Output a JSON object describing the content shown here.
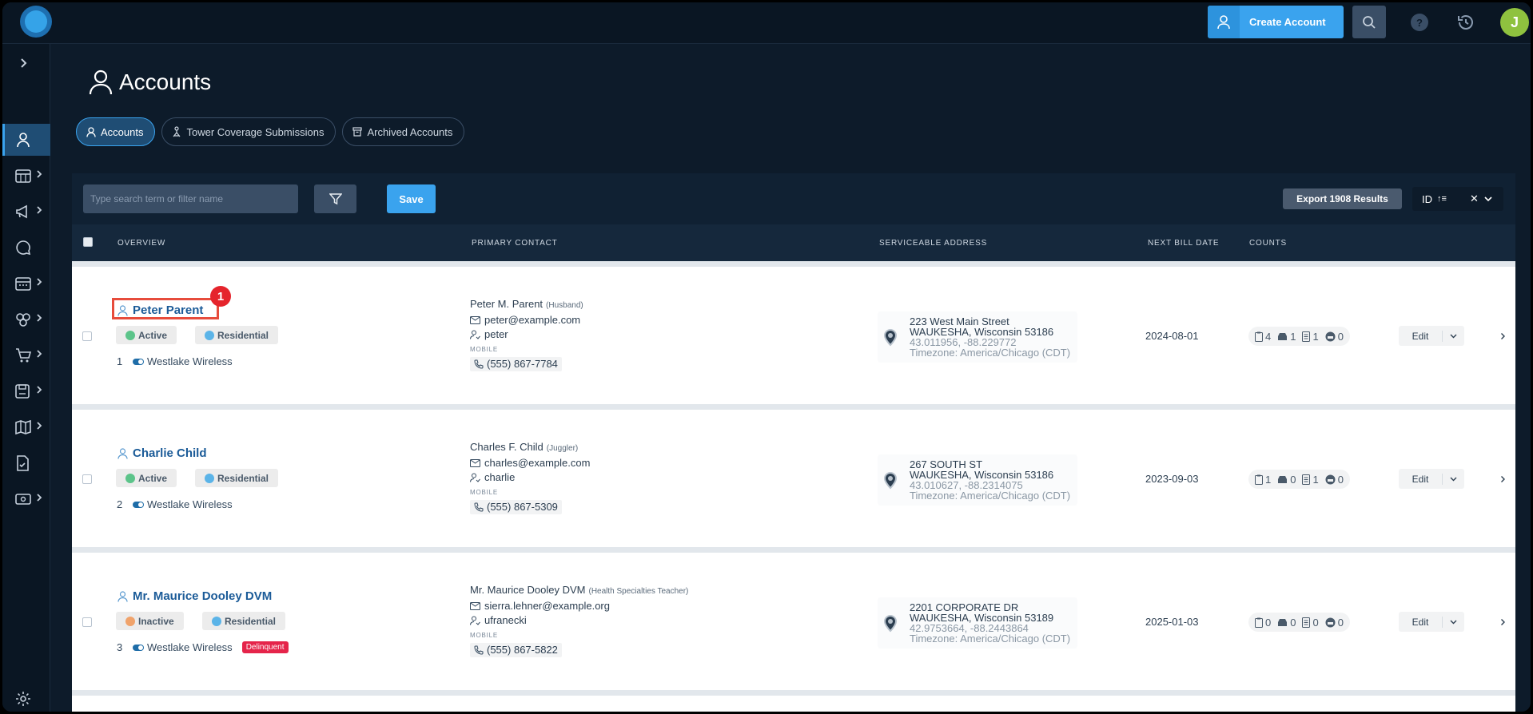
{
  "topbar": {
    "create_label": "Create Account",
    "help_label": "?",
    "avatar_initial": "J"
  },
  "page": {
    "title": "Accounts"
  },
  "tabs": [
    {
      "label": "Accounts",
      "icon": "user-icon",
      "active": true
    },
    {
      "label": "Tower Coverage Submissions",
      "icon": "tower-icon",
      "active": false
    },
    {
      "label": "Archived Accounts",
      "icon": "archive-icon",
      "active": false
    }
  ],
  "toolbar": {
    "search_placeholder": "Type search term or filter name",
    "save_label": "Save",
    "export_label": "Export 1908 Results",
    "sort_field": "ID"
  },
  "table": {
    "headers": [
      "OVERVIEW",
      "PRIMARY CONTACT",
      "SERVICEABLE ADDRESS",
      "NEXT BILL DATE",
      "COUNTS"
    ],
    "rows": [
      {
        "name": "Peter Parent",
        "callout": "1",
        "status": "Active",
        "type": "Residential",
        "id": "1",
        "provider": "Westlake Wireless",
        "delinquent": "",
        "contact_name": "Peter M. Parent",
        "contact_relation": "(Husband)",
        "email": "peter@example.com",
        "username": "peter",
        "phone_label": "MOBILE",
        "phone": "(555) 867-7784",
        "addr_line1": "223 West Main Street",
        "addr_line2": "WAUKESHA, Wisconsin 53186",
        "coords": "43.011956, -88.229772",
        "timezone": "Timezone: America/Chicago (CDT)",
        "bill_date": "2024-08-01",
        "counts": [
          "4",
          "1",
          "1",
          "0"
        ],
        "edit_label": "Edit"
      },
      {
        "name": "Charlie Child",
        "callout": "",
        "status": "Active",
        "type": "Residential",
        "id": "2",
        "provider": "Westlake Wireless",
        "delinquent": "",
        "contact_name": "Charles F. Child",
        "contact_relation": "(Juggler)",
        "email": "charles@example.com",
        "username": "charlie",
        "phone_label": "MOBILE",
        "phone": "(555) 867-5309",
        "addr_line1": "267 SOUTH ST",
        "addr_line2": "WAUKESHA, Wisconsin 53186",
        "coords": "43.010627, -88.2314075",
        "timezone": "Timezone: America/Chicago (CDT)",
        "bill_date": "2023-09-03",
        "counts": [
          "1",
          "0",
          "1",
          "0"
        ],
        "edit_label": "Edit"
      },
      {
        "name": "Mr. Maurice Dooley DVM",
        "callout": "",
        "status": "Inactive",
        "type": "Residential",
        "id": "3",
        "provider": "Westlake Wireless",
        "delinquent": "Delinquent",
        "contact_name": "Mr. Maurice Dooley DVM",
        "contact_relation": "(Health Specialties Teacher)",
        "email": "sierra.lehner@example.org",
        "username": "ufranecki",
        "phone_label": "MOBILE",
        "phone": "(555) 867-5822",
        "addr_line1": "2201 CORPORATE DR",
        "addr_line2": "WAUKESHA, Wisconsin 53189",
        "coords": "42.9753664, -88.2443864",
        "timezone": "Timezone: America/Chicago (CDT)",
        "bill_date": "2025-01-03",
        "counts": [
          "0",
          "0",
          "0",
          "0"
        ],
        "edit_label": "Edit"
      }
    ]
  },
  "colors": {
    "accent": "#3aa3ee",
    "active_dot": "#5cc48a",
    "inactive_dot": "#f0a36b",
    "residential_dot": "#5bb4e8",
    "delinquent": "#e5244a",
    "callout": "#e5242c"
  }
}
